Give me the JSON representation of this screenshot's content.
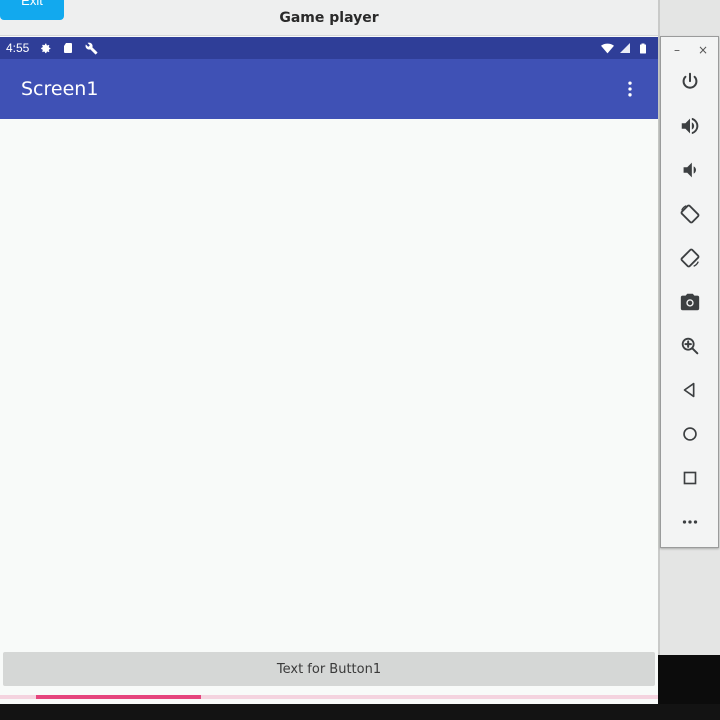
{
  "window": {
    "title": "Game player",
    "exit_label": "Exit"
  },
  "statusbar": {
    "time": "4:55"
  },
  "appbar": {
    "title": "Screen1"
  },
  "main": {
    "button1_label": "Text for Button1"
  },
  "progress": {
    "value_fraction": 0.25
  },
  "side_panel": {
    "minimize_label": "–",
    "close_label": "×",
    "tools": [
      "power-icon",
      "volume-up-icon",
      "volume-down-icon",
      "rotate-left-icon",
      "rotate-right-icon",
      "camera-icon",
      "zoom-icon",
      "back-icon",
      "home-icon",
      "overview-icon",
      "more-icon"
    ]
  },
  "colors": {
    "status_bar": "#2f3e98",
    "app_bar": "#3f51b5",
    "exit_button": "#12a9ee",
    "progress": "#e5457d"
  }
}
